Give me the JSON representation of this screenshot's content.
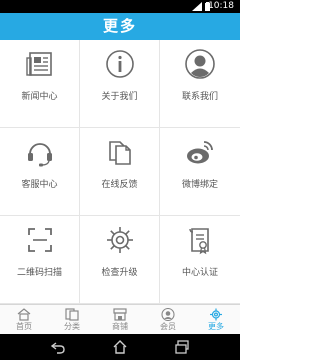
{
  "status_bar": {
    "time": "10:18"
  },
  "header": {
    "title": "更多"
  },
  "grid": {
    "items": [
      {
        "label": "新闻中心",
        "icon": "news-icon"
      },
      {
        "label": "关于我们",
        "icon": "info-icon"
      },
      {
        "label": "联系我们",
        "icon": "contact-icon"
      },
      {
        "label": "客服中心",
        "icon": "headset-icon"
      },
      {
        "label": "在线反馈",
        "icon": "feedback-icon"
      },
      {
        "label": "微博绑定",
        "icon": "weibo-icon"
      },
      {
        "label": "二维码扫描",
        "icon": "qr-scan-icon"
      },
      {
        "label": "检查升级",
        "icon": "gear-icon"
      },
      {
        "label": "中心认证",
        "icon": "certificate-icon"
      }
    ]
  },
  "tabbar": {
    "tabs": [
      {
        "label": "首页",
        "icon": "home-icon"
      },
      {
        "label": "分类",
        "icon": "category-icon"
      },
      {
        "label": "商铺",
        "icon": "store-icon"
      },
      {
        "label": "会员",
        "icon": "member-icon"
      },
      {
        "label": "更多",
        "icon": "more-gear-icon",
        "active": true
      }
    ]
  },
  "colors": {
    "accent": "#27a9e3",
    "icon_gray": "#6b6b6b",
    "nav": "#000000"
  }
}
